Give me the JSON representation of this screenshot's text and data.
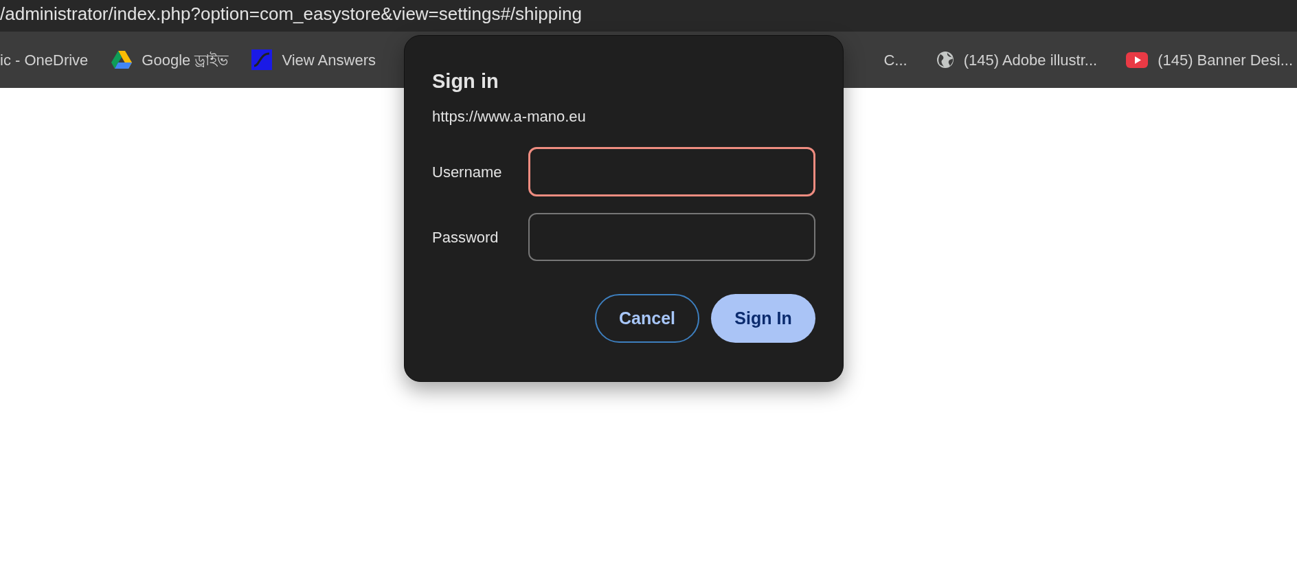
{
  "address_bar": {
    "url": "/administrator/index.php?option=com_easystore&view=settings#/shipping"
  },
  "bookmarks": [
    {
      "label": "ic - OneDrive",
      "kind": "none"
    },
    {
      "label": "Google ড্রাইভ",
      "kind": "drive"
    },
    {
      "label": "View Answers",
      "kind": "answers"
    },
    {
      "label": "C...",
      "kind": "none"
    },
    {
      "label": "(145) Adobe illustr...",
      "kind": "globe"
    },
    {
      "label": "(145) Banner Desi...",
      "kind": "youtube"
    }
  ],
  "dialog": {
    "title": "Sign in",
    "origin": "https://www.a-mano.eu",
    "fields": [
      {
        "label": "Username",
        "focused": true
      },
      {
        "label": "Password",
        "focused": false
      }
    ],
    "buttons": [
      {
        "label": "Cancel",
        "kind": "secondary"
      },
      {
        "label": "Sign In",
        "kind": "primary"
      }
    ]
  }
}
